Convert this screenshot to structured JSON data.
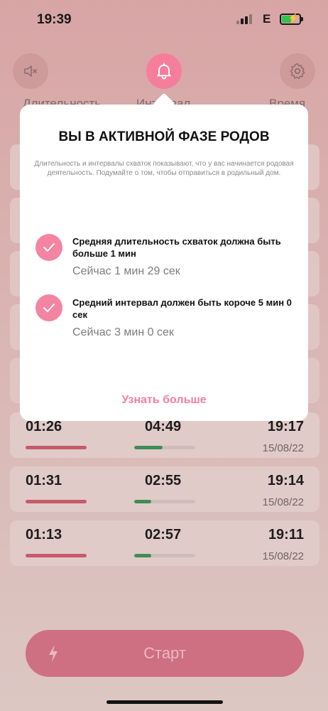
{
  "status": {
    "time": "19:39",
    "network": "E"
  },
  "tabs": [
    {
      "label": "Длительность"
    },
    {
      "label": "Интервал"
    },
    {
      "label": "Время"
    }
  ],
  "rows": [
    {
      "duration": "01:26",
      "interval": "04:49",
      "time": "19:17",
      "date": "15/08/22",
      "interval_fraction": 0.47
    },
    {
      "duration": "01:31",
      "interval": "02:55",
      "time": "19:14",
      "date": "15/08/22",
      "interval_fraction": 0.28
    },
    {
      "duration": "01:13",
      "interval": "02:57",
      "time": "19:11",
      "date": "15/08/22",
      "interval_fraction": 0.28
    }
  ],
  "start_button": {
    "label": "Старт"
  },
  "modal": {
    "title": "ВЫ В АКТИВНОЙ ФАЗЕ РОДОВ",
    "description": "Длительность и интервалы схваток показывают, что у вас начинается родовая деятельность. Подумайте о том, чтобы отправиться в родильный дом.",
    "requirements": [
      {
        "title": "Средняя длительность схваток должна быть больше 1 мин",
        "current": "Сейчас 1 мин 29 сек"
      },
      {
        "title": "Средний интервал должен быть короче 5 мин 0 сек",
        "current": "Сейчас 3 мин 0 сек"
      }
    ],
    "learn_more": "Узнать больше"
  },
  "colors": {
    "accent": "#f57e9c",
    "duration_bar": "#c65a6c",
    "interval_bar": "#3f8d55"
  }
}
